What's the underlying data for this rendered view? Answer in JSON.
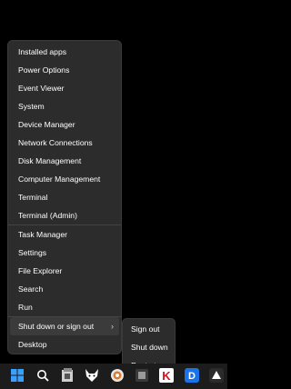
{
  "context_menu": {
    "items": [
      {
        "label": "Installed apps"
      },
      {
        "label": "Power Options"
      },
      {
        "label": "Event Viewer"
      },
      {
        "label": "System"
      },
      {
        "label": "Device Manager"
      },
      {
        "label": "Network Connections"
      },
      {
        "label": "Disk Management"
      },
      {
        "label": "Computer Management"
      },
      {
        "label": "Terminal"
      },
      {
        "label": "Terminal (Admin)"
      },
      {
        "label": "Task Manager"
      },
      {
        "label": "Settings"
      },
      {
        "label": "File Explorer"
      },
      {
        "label": "Search"
      },
      {
        "label": "Run"
      },
      {
        "label": "Shut down or sign out"
      },
      {
        "label": "Desktop"
      }
    ]
  },
  "submenu": {
    "items": [
      {
        "label": "Sign out"
      },
      {
        "label": "Shut down"
      },
      {
        "label": "Restart"
      }
    ]
  },
  "taskbar": {
    "icons": [
      "windows-start-icon",
      "search-icon",
      "file-explorer-icon",
      "wolf-app-icon",
      "browser-icon",
      "k-app-icon",
      "d-app-icon",
      "app-icon"
    ],
    "accent": "#0078d4"
  }
}
